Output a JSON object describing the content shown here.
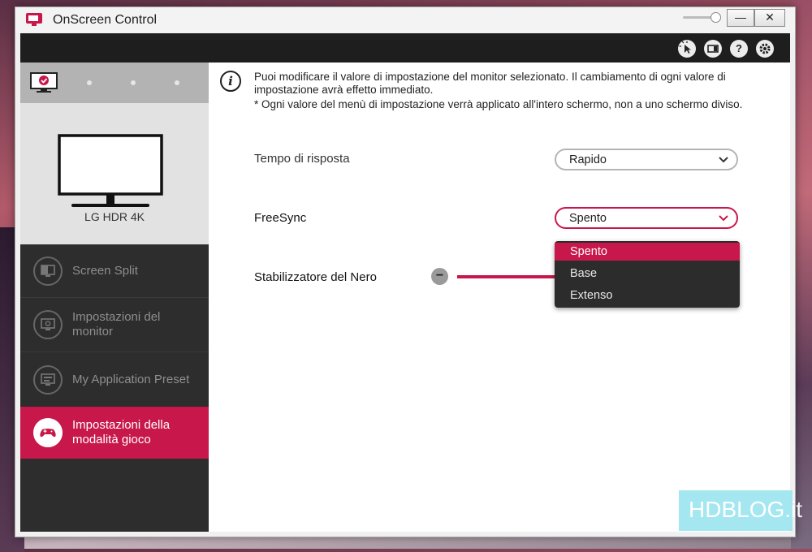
{
  "window": {
    "title": "OnScreen Control",
    "minimize_label": "—",
    "close_label": "✕",
    "brand_color": "#c8174a"
  },
  "toolbar": {
    "icons": [
      "cursor-icon",
      "display-icon",
      "help-icon",
      "gear-icon"
    ],
    "help_glyph": "?"
  },
  "sidebar": {
    "monitor_name": "LG HDR 4K",
    "items": [
      {
        "label": "Screen Split",
        "icon": "screen-split-icon",
        "active": false
      },
      {
        "label": "Impostazioni del monitor",
        "icon": "monitor-settings-icon",
        "active": false
      },
      {
        "label": "My Application Preset",
        "icon": "app-preset-icon",
        "active": false
      },
      {
        "label": "Impostazioni della modalità gioco",
        "icon": "gamepad-icon",
        "active": true
      }
    ]
  },
  "main": {
    "info_glyph": "i",
    "info_text": "Puoi modificare il valore di impostazione del monitor selezionato. Il cambiamento di ogni valore di impostazione avrà effetto immediato.",
    "info_note": "* Ogni valore del menù di impostazione verrà applicato all'intero schermo, non a uno schermo diviso.",
    "settings": [
      {
        "label": "Tempo di risposta",
        "value": "Rapido"
      },
      {
        "label": "FreeSync",
        "value": "Spento"
      },
      {
        "label": "Stabilizzatore del Nero"
      }
    ],
    "minus_glyph": "−",
    "dropdown": {
      "options": [
        "Spento",
        "Base",
        "Extenso"
      ],
      "selected": "Spento"
    }
  },
  "watermark": {
    "text": "HDBLOG.it"
  }
}
